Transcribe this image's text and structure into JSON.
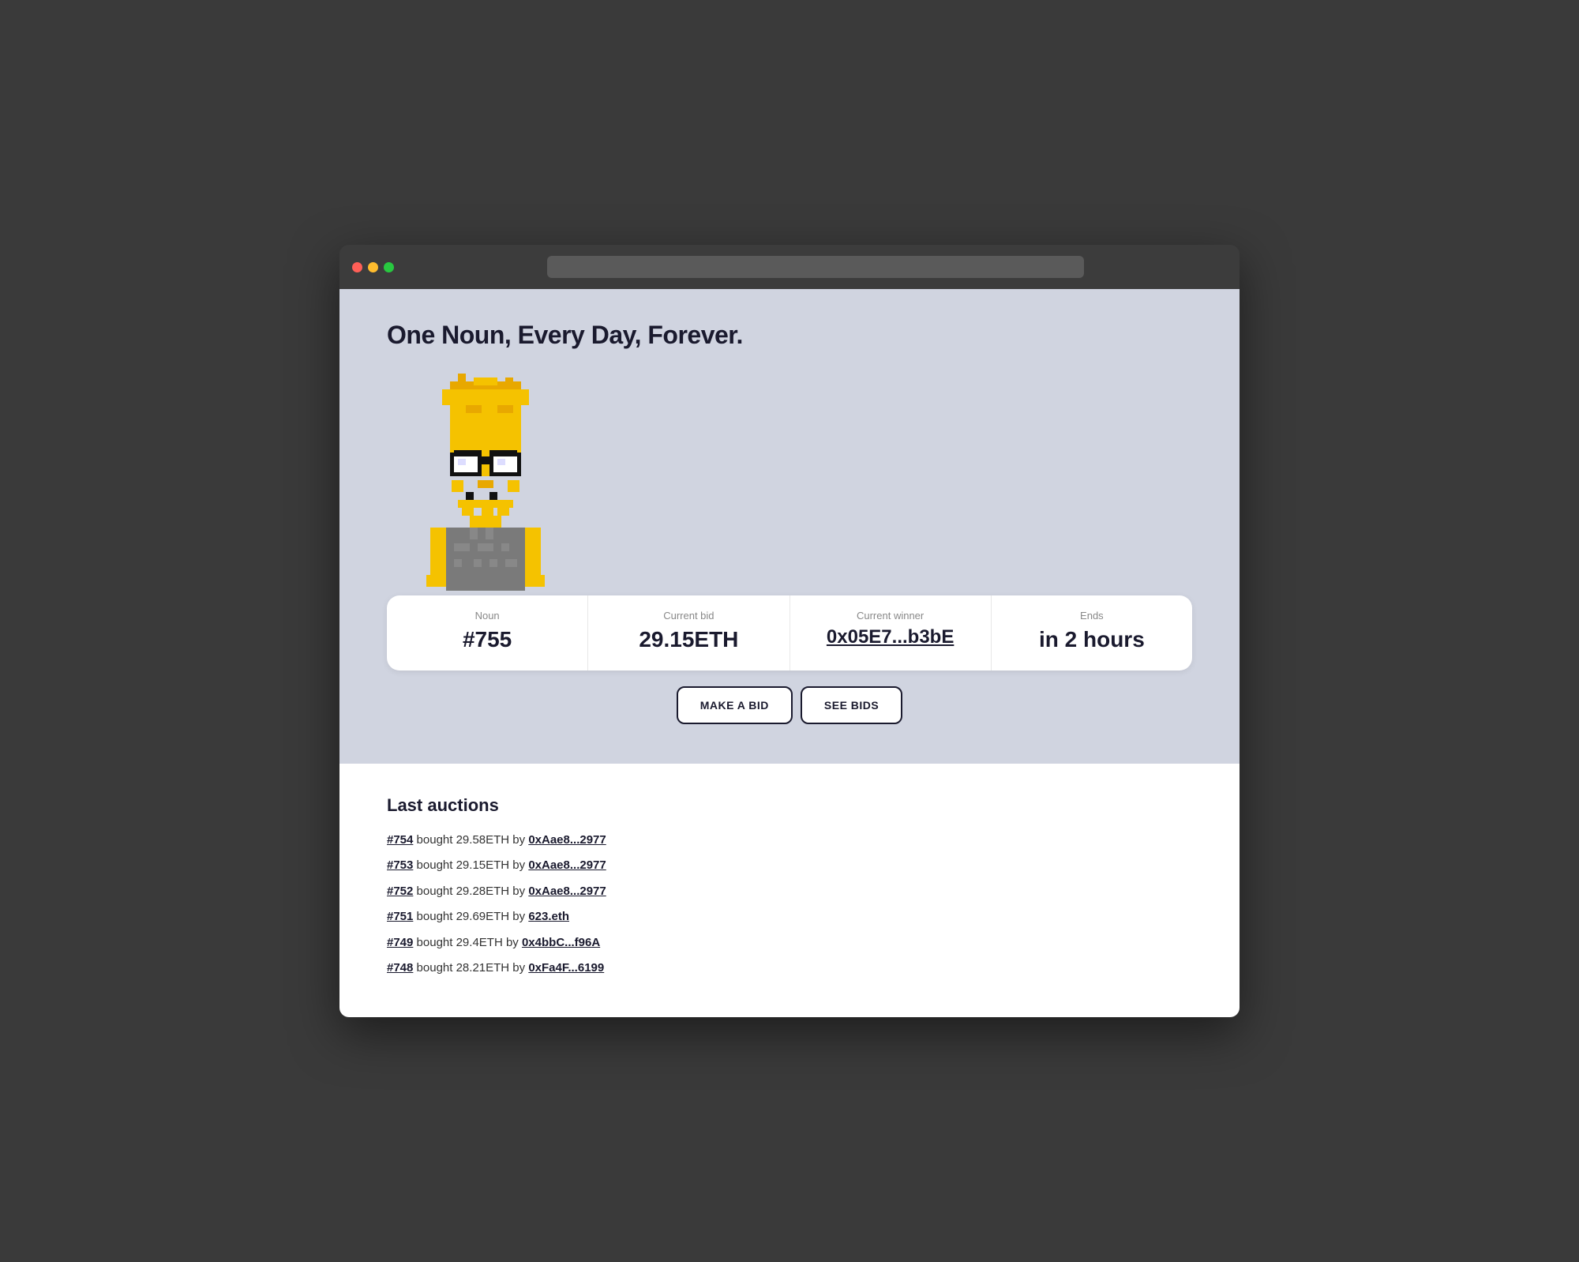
{
  "browser": {
    "address_bar_placeholder": ""
  },
  "page": {
    "title": "One Noun, Every Day, Forever."
  },
  "auction": {
    "noun_label": "Noun",
    "noun_value": "#755",
    "bid_label": "Current bid",
    "bid_value": "29.15ETH",
    "winner_label": "Current winner",
    "winner_value": "0x05E7...b3bE",
    "ends_label": "Ends",
    "ends_value": "in 2 hours"
  },
  "buttons": {
    "make_bid": "MAKE A BID",
    "see_bids": "SEE BIDS"
  },
  "last_auctions": {
    "title": "Last auctions",
    "items": [
      {
        "id": "#754",
        "text": "bought 29.58ETH by",
        "buyer": "0xAae8...2977"
      },
      {
        "id": "#753",
        "text": "bought 29.15ETH by",
        "buyer": "0xAae8...2977"
      },
      {
        "id": "#752",
        "text": "bought 29.28ETH by",
        "buyer": "0xAae8...2977"
      },
      {
        "id": "#751",
        "text": "bought 29.69ETH by",
        "buyer": "623.eth"
      },
      {
        "id": "#749",
        "text": "bought 29.4ETH by",
        "buyer": "0x4bbC...f96A"
      },
      {
        "id": "#748",
        "text": "bought 28.21ETH by",
        "buyer": "0xFa4F...6199"
      }
    ]
  },
  "colors": {
    "accent": "#1a1a2e",
    "background": "#d0d4e0",
    "white": "#ffffff",
    "link": "#1a1a2e"
  }
}
